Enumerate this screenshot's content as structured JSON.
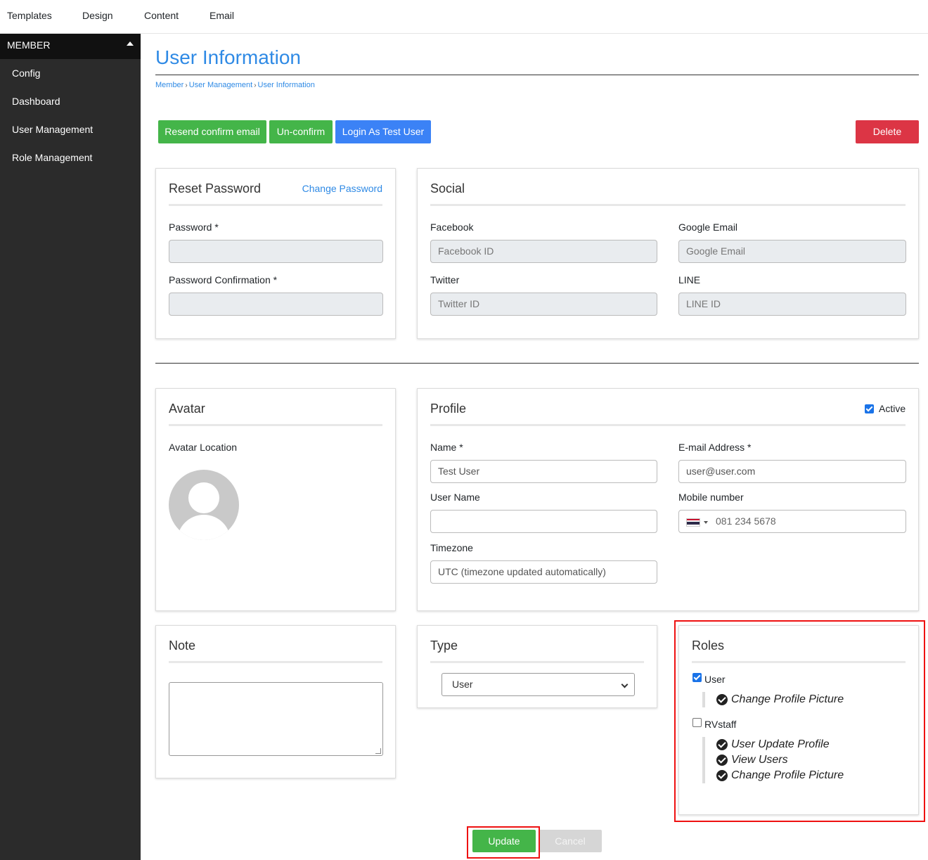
{
  "topnav": {
    "items": [
      "Templates",
      "Design",
      "Content",
      "Email"
    ]
  },
  "sidebar": {
    "header": "MEMBER",
    "items": [
      "Config",
      "Dashboard",
      "User Management",
      "Role Management"
    ]
  },
  "page": {
    "title": "User Information",
    "breadcrumb": [
      "Member",
      "User Management",
      "User Information"
    ]
  },
  "actions": {
    "resend": "Resend confirm email",
    "unconfirm": "Un-confirm",
    "login_as": "Login As Test User",
    "delete": "Delete"
  },
  "reset_password": {
    "title": "Reset Password",
    "change_link": "Change Password",
    "password_label": "Password *",
    "password_value": "",
    "confirm_label": "Password Confirmation *",
    "confirm_value": ""
  },
  "social": {
    "title": "Social",
    "facebook_label": "Facebook",
    "facebook_placeholder": "Facebook ID",
    "google_label": "Google Email",
    "google_placeholder": "Google Email",
    "twitter_label": "Twitter",
    "twitter_placeholder": "Twitter ID",
    "line_label": "LINE",
    "line_placeholder": "LINE ID"
  },
  "avatar": {
    "title": "Avatar",
    "location_label": "Avatar Location"
  },
  "profile": {
    "title": "Profile",
    "active_label": "Active",
    "active_checked": true,
    "name_label": "Name *",
    "name_value": "Test User",
    "email_label": "E-mail Address *",
    "email_value": "user@user.com",
    "username_label": "User Name",
    "username_value": "",
    "mobile_label": "Mobile number",
    "mobile_placeholder": "081 234 5678",
    "timezone_label": "Timezone",
    "timezone_value": "UTC (timezone updated automatically)"
  },
  "note": {
    "title": "Note",
    "value": ""
  },
  "type": {
    "title": "Type",
    "selected": "User"
  },
  "roles": {
    "title": "Roles",
    "groups": [
      {
        "name": "User",
        "checked": true,
        "permissions": [
          "Change Profile Picture"
        ]
      },
      {
        "name": "RVstaff",
        "checked": false,
        "permissions": [
          "User Update Profile",
          "View Users",
          "Change Profile Picture"
        ]
      }
    ]
  },
  "footer": {
    "update": "Update",
    "cancel": "Cancel"
  },
  "colors": {
    "accent": "#2f8ae5",
    "green": "#44b549",
    "blue": "#3b82f6",
    "red": "#dc3545",
    "highlight": "#ee1111"
  }
}
